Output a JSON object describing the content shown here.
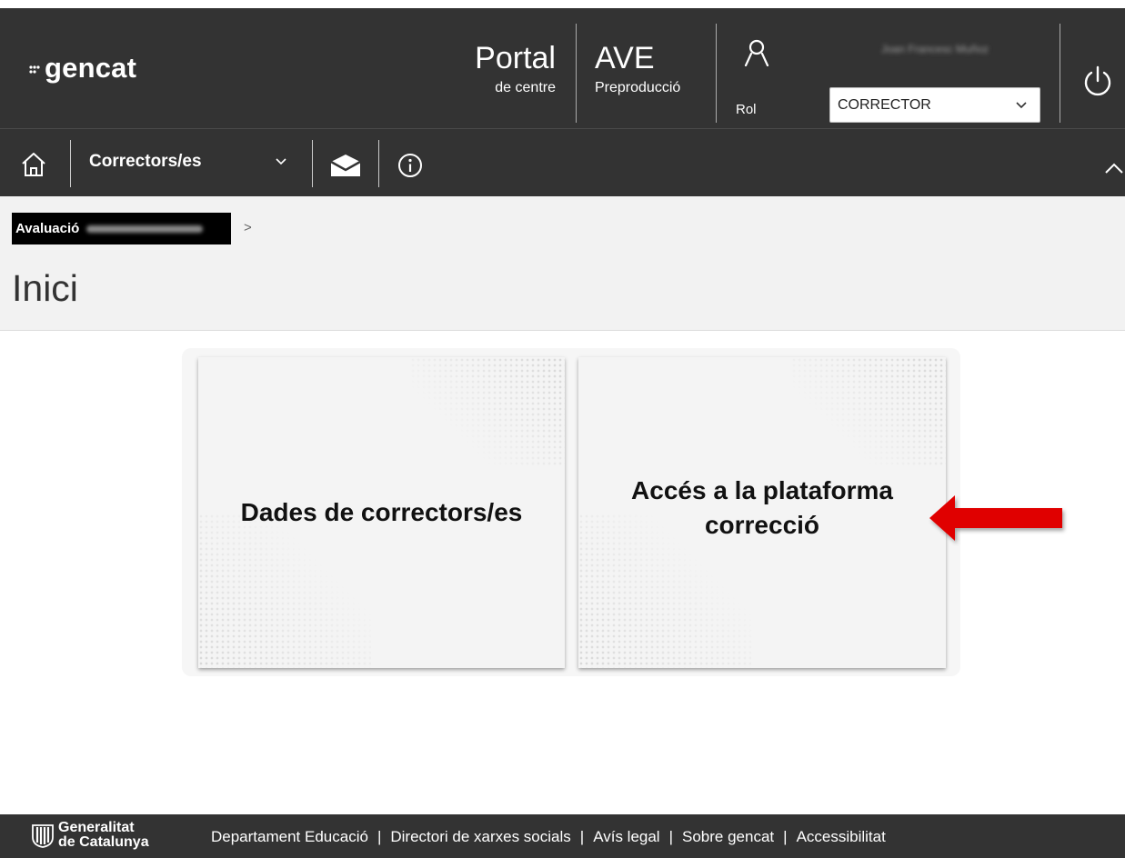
{
  "header": {
    "logo_text": "gencat",
    "portal_title": "Portal",
    "portal_subtitle": "de centre",
    "app_title": "AVE",
    "app_subtitle": "Preproducció",
    "rol_label": "Rol",
    "username": "Joan Francesc Muñoz",
    "role_selected": "CORRECTOR"
  },
  "nav": {
    "section_label": "Correctors/es"
  },
  "breadcrumb": {
    "item_label": "Avaluació",
    "separator": ">"
  },
  "page": {
    "title": "Inici"
  },
  "cards": [
    {
      "label": "Dades de correctors/es"
    },
    {
      "label": "Accés a la plataforma correcció"
    }
  ],
  "annotation": {
    "arrow_color": "#e00000"
  },
  "footer": {
    "org_line1": "Generalitat",
    "org_line2": "de Catalunya",
    "links": [
      "Departament Educació",
      "Directori de xarxes socials",
      "Avís legal",
      "Sobre gencat",
      "Accessibilitat"
    ]
  }
}
